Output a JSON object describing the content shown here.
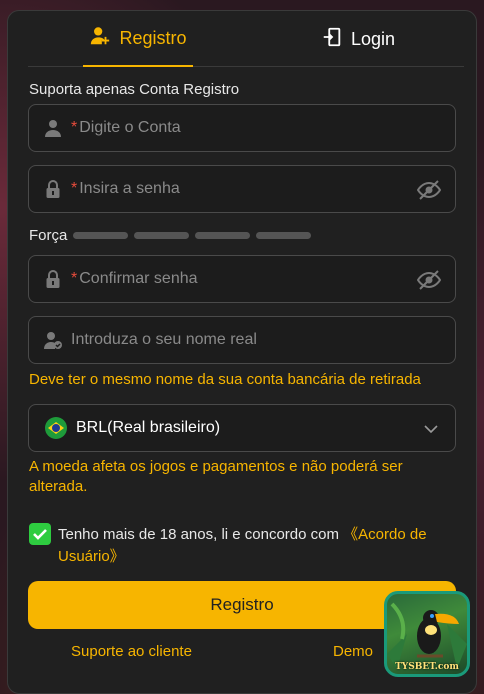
{
  "tabs": {
    "register": "Registro",
    "login": "Login"
  },
  "form": {
    "account_hint": "Suporta apenas Conta Registro",
    "account_placeholder": "Digite o Conta",
    "password_placeholder": "Insira a senha",
    "strength_label": "Força",
    "strength_level": 0,
    "confirm_placeholder": "Confirmar senha",
    "realname_placeholder": "Introduza o seu nome real",
    "realname_note": "Deve ter o mesmo nome da sua conta bancária de retirada",
    "required_mark": "*"
  },
  "currency": {
    "selected": "BRL(Real brasileiro)",
    "note": "A moeda afeta os jogos e pagamentos e não poderá ser alterada."
  },
  "agreement": {
    "checked": true,
    "text": "Tenho mais de 18 anos, li e concordo com ",
    "link": "《Acordo de Usuário》"
  },
  "submit_label": "Registro",
  "footer": {
    "support": "Suporte ao cliente",
    "demo": "Demo"
  },
  "badge": {
    "brand": "TYSBET.com"
  },
  "colors": {
    "accent": "#f7b500",
    "check": "#2ecc40",
    "panel": "#202020",
    "required": "#e74c3c"
  }
}
